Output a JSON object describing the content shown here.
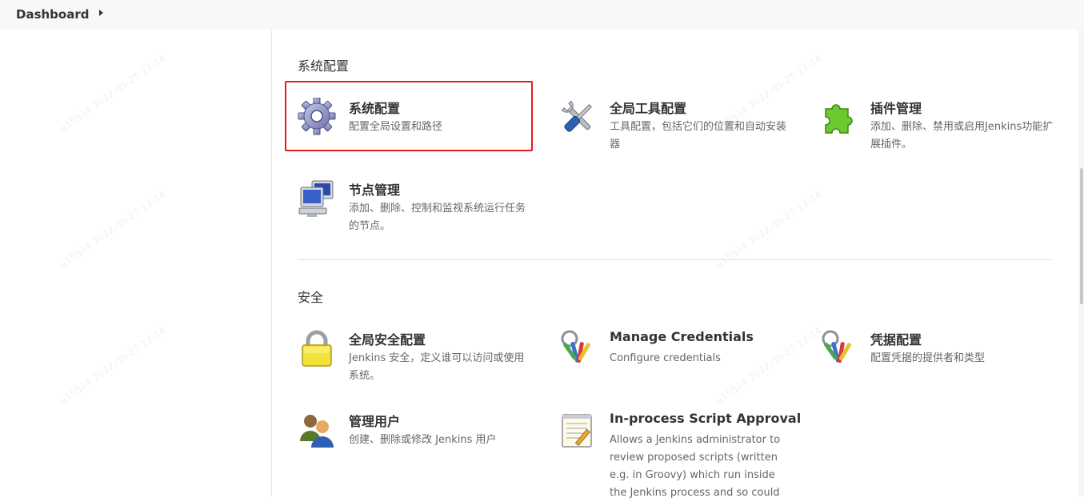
{
  "breadcrumb": {
    "label": "Dashboard"
  },
  "sections": {
    "system": {
      "title": "系统配置",
      "items": [
        {
          "title": "系统配置",
          "desc": "配置全局设置和路径",
          "icon": "gear-icon"
        },
        {
          "title": "全局工具配置",
          "desc": "工具配置，包括它们的位置和自动安装器",
          "icon": "tools-icon"
        },
        {
          "title": "插件管理",
          "desc": "添加、删除、禁用或启用Jenkins功能扩展插件。",
          "icon": "puzzle-icon"
        },
        {
          "title": "节点管理",
          "desc": "添加、删除、控制和监视系统运行任务的节点。",
          "icon": "computer-icon"
        }
      ]
    },
    "security": {
      "title": "安全",
      "items": [
        {
          "title": "全局安全配置",
          "desc": "Jenkins 安全，定义谁可以访问或使用系统。",
          "icon": "lock-icon"
        },
        {
          "title": "Manage Credentials",
          "desc": "Configure credentials",
          "icon": "keys-icon"
        },
        {
          "title": "凭据配置",
          "desc": "配置凭据的提供者和类型",
          "icon": "keys-icon"
        },
        {
          "title": "管理用户",
          "desc": "创建、删除或修改 Jenkins 用户",
          "icon": "users-icon"
        },
        {
          "title": "In-process Script Approval",
          "desc": "Allows a Jenkins administrator to review proposed scripts (written e.g. in Groovy) which run inside the Jenkins process and so could",
          "icon": "notepad-icon"
        }
      ]
    }
  },
  "watermark": {
    "text": "w15514 2022-05-25 12:14"
  },
  "colors": {
    "highlight": "#e31b1b",
    "topbar": "#f8f8f8"
  }
}
